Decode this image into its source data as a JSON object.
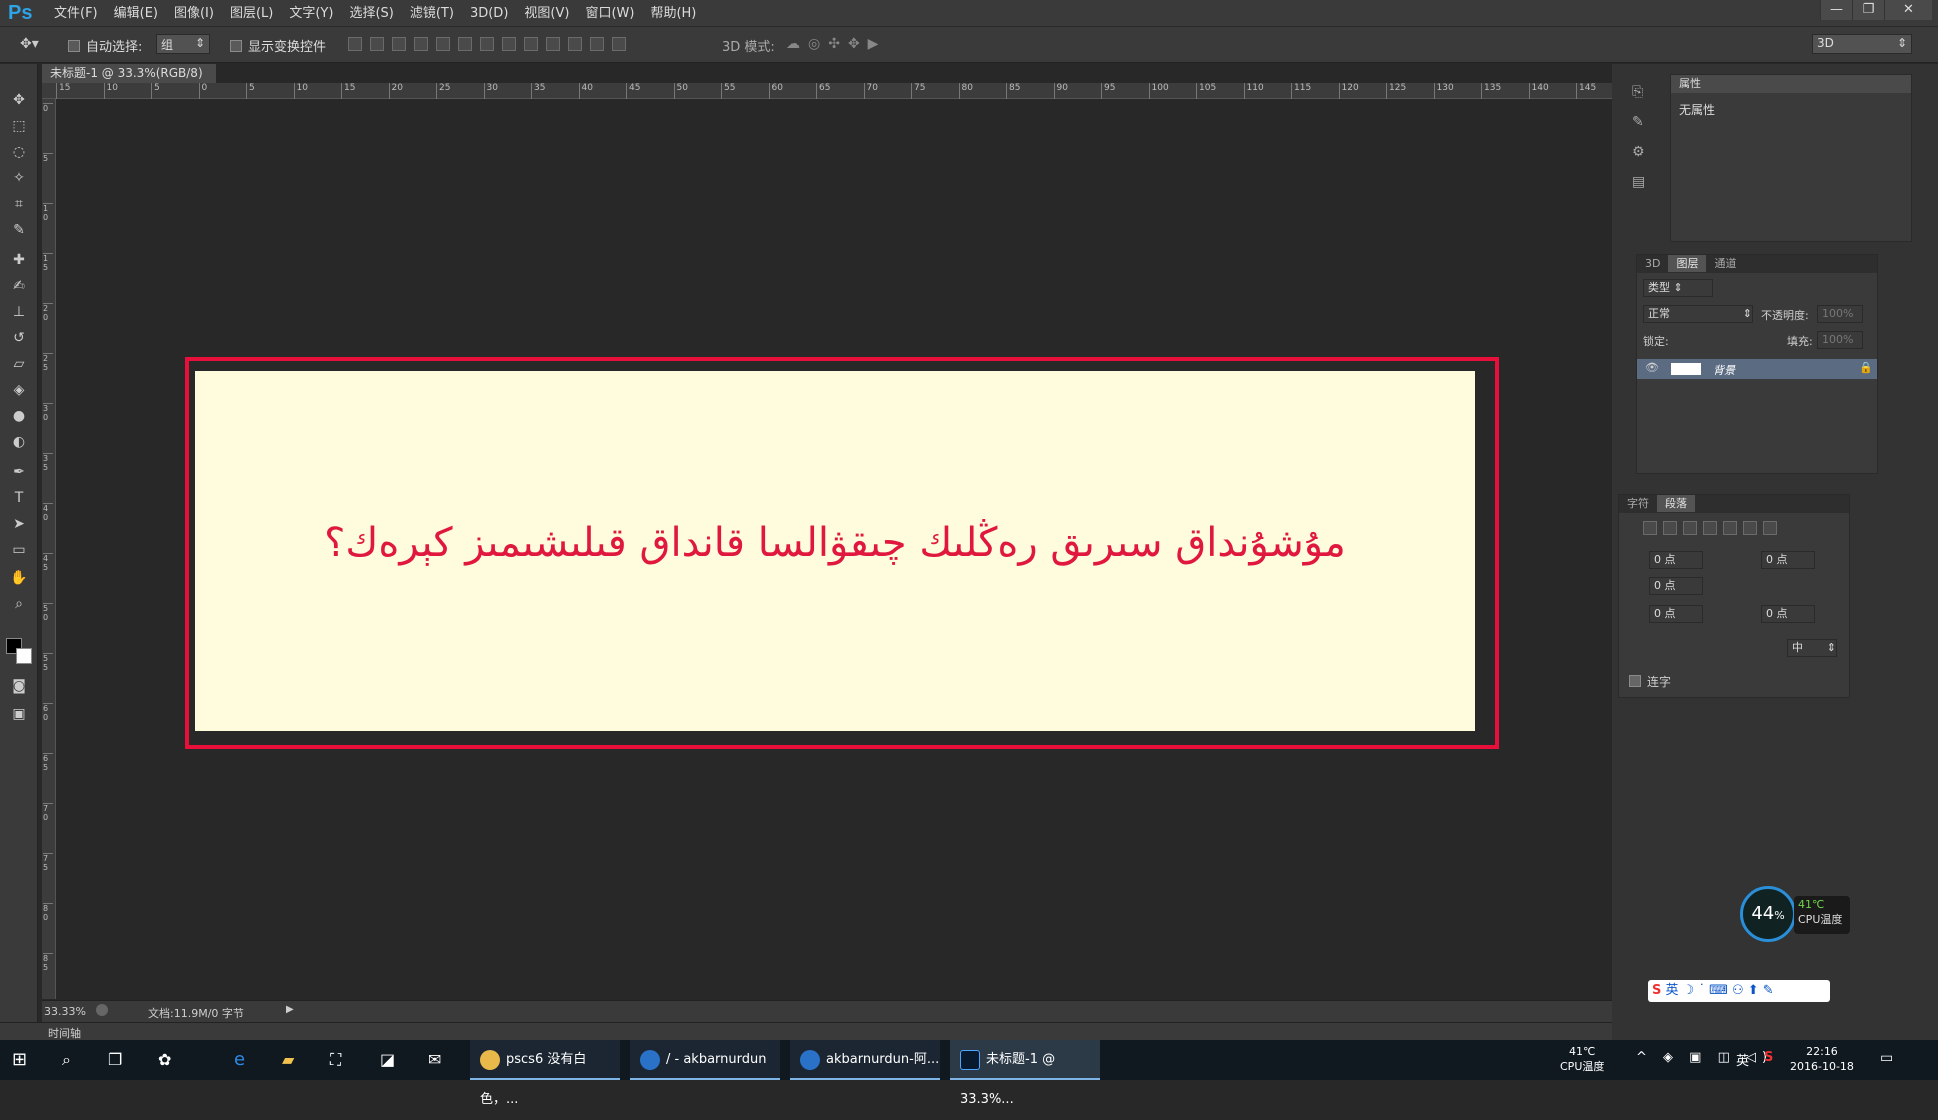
{
  "app": {
    "logo": "Ps"
  },
  "menu": [
    "文件(F)",
    "编辑(E)",
    "图像(I)",
    "图层(L)",
    "文字(Y)",
    "选择(S)",
    "滤镜(T)",
    "3D(D)",
    "视图(V)",
    "窗口(W)",
    "帮助(H)"
  ],
  "window_controls": {
    "minimize": "—",
    "restore": "❐",
    "close": "✕"
  },
  "options": {
    "auto_select_label": "自动选择:",
    "auto_select_value": "组",
    "show_transform_label": "显示变换控件",
    "mode3d_label": "3D 模式:",
    "workspace": "3D"
  },
  "document": {
    "tab_title": "未标题-1 @ 33.3%(RGB/8)",
    "tab_close": "×",
    "text": "مۇشۇنداق سىرىق رەڭلىك چىقۋالسا قانداق قىلىشىمىز كېرەك؟",
    "bg_color": "#fefcdc",
    "frame_color": "#e8103a",
    "text_color": "#e0173e"
  },
  "ruler_top": [
    "15",
    "10",
    "5",
    "0",
    "5",
    "10",
    "15",
    "20",
    "25",
    "30",
    "35",
    "40",
    "45",
    "50",
    "55",
    "60",
    "65",
    "70",
    "75",
    "80",
    "85",
    "90",
    "95",
    "100",
    "105",
    "110",
    "115",
    "120",
    "125",
    "130",
    "135",
    "140",
    "145"
  ],
  "ruler_left": [
    "0",
    "5",
    "10",
    "15",
    "20",
    "25",
    "30",
    "35",
    "40",
    "45",
    "50",
    "55",
    "60",
    "65",
    "70",
    "75",
    "80",
    "85"
  ],
  "status": {
    "zoom": "33.33%",
    "doc_info": "文档:11.9M/0 字节",
    "timeline": "时间轴"
  },
  "properties_panel": {
    "title": "属性",
    "content": "无属性"
  },
  "layers_panel": {
    "tabs": [
      "3D",
      "图层",
      "通道"
    ],
    "active_tab": "图层",
    "filter_kind": "类型",
    "blend_mode": "正常",
    "opacity_label": "不透明度:",
    "opacity_value": "100%",
    "lock_label": "锁定:",
    "fill_label": "填充:",
    "fill_value": "100%",
    "layer_name": "背景"
  },
  "paragraph_panel": {
    "tabs": [
      "字符",
      "段落"
    ],
    "active_tab": "段落",
    "indent_left": "0 点",
    "indent_right": "0 点",
    "first_line": "0 点",
    "space_before": "0 点",
    "space_after": "0 点",
    "kashida": "中",
    "hyphenate_label": "连字"
  },
  "cpu_widget": {
    "percent": "44",
    "pct_sign": "%",
    "temp": "41℃",
    "label": "CPU温度"
  },
  "ime": {
    "lang": "英"
  },
  "taskbar": {
    "apps": [
      {
        "label": "pscs6 没有白色，..."
      },
      {
        "label": "/ - akbarnurdun"
      },
      {
        "label": "akbarnurdun-阿..."
      },
      {
        "label": "未标题-1 @ 33.3%..."
      }
    ],
    "cpu_temp": "41℃",
    "cpu_label": "CPU温度",
    "ime_lang": "英",
    "time": "22:16",
    "date": "2016-10-18"
  }
}
